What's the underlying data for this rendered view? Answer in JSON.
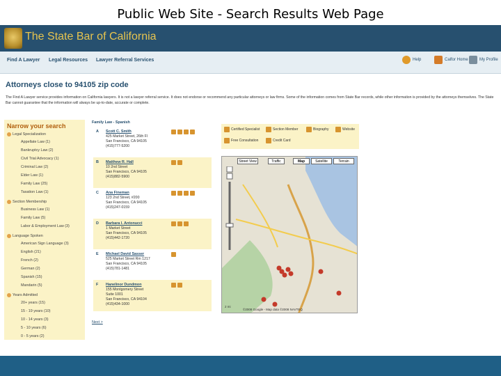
{
  "slide_title": "Public Web Site - Search Results Web Page",
  "site": {
    "brand": "The State Bar of California",
    "nav": [
      "Find A Lawyer",
      "Legal Resources",
      "Lawyer Referral Services"
    ],
    "util": [
      "Help",
      "Calfor Home",
      "My Profile"
    ],
    "heading": "Attorneys close to 94105 zip code",
    "intro": "The Find A Lawyer service provides information on California lawyers. It is not a lawyer referral service. It does not endorse or recommend any particular attorneys or law firms. Some of the information comes from State Bar records, while other information is provided by the attorneys themselves. The State Bar cannot guarantee that the information will always be up-to-date, accurate or complete."
  },
  "sidebar": {
    "title": "Narrow your search",
    "sections": [
      {
        "head": "Legal Specialization",
        "items": [
          "Appellate Law (1)",
          "Bankruptcy Law (2)",
          "Civil Trial Advocacy (1)",
          "Criminal Law (2)",
          "Elder Law (1)",
          "Family Law (25)",
          "Taxation Law (1)"
        ]
      },
      {
        "head": "Section Membership",
        "items": [
          "Business Law (1)",
          "Family Law (5)",
          "Labor & Employment Law (3)"
        ]
      },
      {
        "head": "Language Spoken",
        "items": [
          "American Sign Language (3)",
          "English (21)",
          "French (2)",
          "German (2)",
          "Spanish (15)",
          "Mandarin (5)"
        ]
      },
      {
        "head": "Years Admitted",
        "items": [
          "20+ years (15)",
          "15 - 19 years (10)",
          "10 - 14 years (3)",
          "5 - 10 years (6)",
          "0 - 5 years (2)"
        ]
      }
    ]
  },
  "results": {
    "filter": "Family Law - Spanish",
    "items": [
      {
        "letter": "A",
        "name": "Scott C. Smith",
        "lines": [
          "425 Market Street, 26th Fl",
          "San Francisco, CA 94105",
          "(415)777-5200"
        ]
      },
      {
        "letter": "B",
        "name": "Matthew R. Hall",
        "lines": [
          "10 2nd Street",
          "San Francisco, CA 94105",
          "(415)882-5900"
        ]
      },
      {
        "letter": "C",
        "name": "Ana Fineman",
        "lines": [
          "123 2nd Street, #200",
          "San Francisco, CA 94105",
          "(415)247-0159"
        ]
      },
      {
        "letter": "D",
        "name": "Barbara I. Antonucci",
        "lines": [
          "1 Market Street",
          "San Francisco, CA 94105",
          "(415)442-1720"
        ]
      },
      {
        "letter": "E",
        "name": "Michael David Sasser",
        "lines": [
          "525 Market Street Rm 1217",
          "San Francisco, CA 94105",
          "(415)781-1481"
        ]
      },
      {
        "letter": "F",
        "name": "Hanelinor Dundmon",
        "lines": [
          "155 Montgomery Street",
          "Suite 1001",
          "San Francisco, CA 94104",
          "(415)434-1000"
        ]
      }
    ],
    "next": "Next >"
  },
  "legend": [
    "Certified Specialist",
    "Section Member",
    "Biography",
    "Website",
    "Free Consultation",
    "Credit Card"
  ],
  "map": {
    "controls": [
      "Street View",
      "Traffic",
      "Map",
      "Satellite",
      "Terrain"
    ],
    "scale": "2 mi",
    "copyright": "©2008 Google - Map data ©2008 NAVTEQ"
  },
  "colors": {
    "header": "#27506f",
    "brand": "#e7c44f",
    "accent": "#b15f0e",
    "panel": "#fbf3c7",
    "footer": "#1f5f86"
  }
}
